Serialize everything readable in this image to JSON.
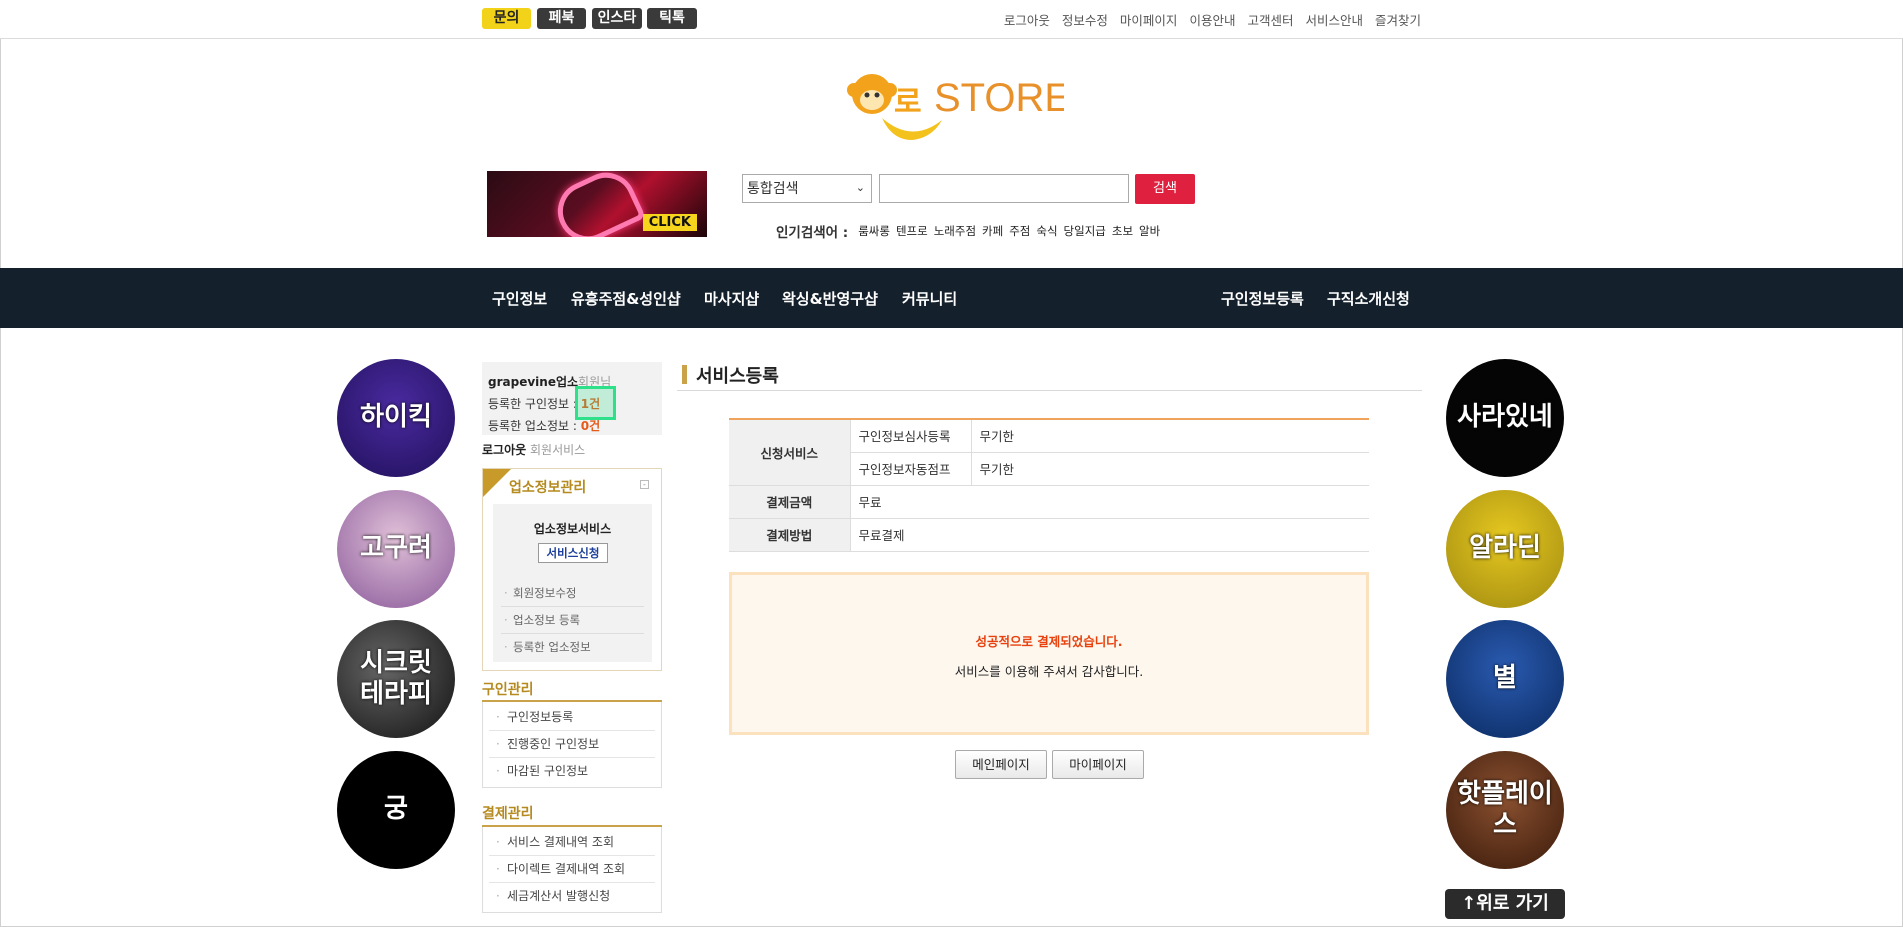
{
  "top": {
    "sns": [
      "문의",
      "페북",
      "인스타",
      "틱톡"
    ],
    "links": [
      "로그아웃",
      "정보수정",
      "마이페이지",
      "이용안내",
      "고객센터",
      "서비스안내",
      "즐겨찾기"
    ]
  },
  "logo": {
    "text": "STORE",
    "prefix": "로"
  },
  "banner": {
    "click": "CLICK"
  },
  "search": {
    "select_value": "통합검색",
    "button": "검색",
    "popular_label": "인기검색어 :",
    "keywords": [
      "룸싸롱",
      "텐프로",
      "노래주점",
      "카페",
      "주점",
      "숙식",
      "당일지급",
      "초보",
      "알바"
    ]
  },
  "nav": {
    "left": [
      "구인정보",
      "유흥주점&성인샵",
      "마사지샵",
      "왁싱&반영구샵",
      "커뮤니티"
    ],
    "right": [
      "구인정보등록",
      "구직소개신청"
    ]
  },
  "left_circles": [
    "하이킥",
    "고구려",
    "시크릿\n테라피",
    "궁"
  ],
  "right_circles": [
    "사라있네",
    "알라딘",
    "별",
    "핫플레이스"
  ],
  "top_button": "↑위로 가기",
  "member": {
    "name": "grapevine업소",
    "suffix": "회원님",
    "jobs_label": "등록한 구인정보 :",
    "jobs_count": "1건",
    "biz_label": "등록한 업소정보 :",
    "biz_count": "0건",
    "logout": "로그아웃",
    "member_service": "회원서비스"
  },
  "biz_panel": {
    "title": "업소정보관리",
    "subtitle": "업소정보서비스",
    "apply": "서비스신청",
    "items": [
      "회원정보수정",
      "업소정보 등록",
      "등록한 업소정보"
    ]
  },
  "job_section": {
    "title": "구인관리",
    "items": [
      "구인정보등록",
      "진행중인 구인정보",
      "마감된 구인정보"
    ]
  },
  "pay_section": {
    "title": "결제관리",
    "items": [
      "서비스 결제내역 조회",
      "다이렉트 결제내역 조회",
      "세금계산서 발행신청"
    ]
  },
  "main": {
    "title": "서비스등록",
    "table": {
      "service_label": "신청서비스",
      "services": [
        {
          "name": "구인정보심사등록",
          "period": "무기한"
        },
        {
          "name": "구인정보자동점프",
          "period": "무기한"
        }
      ],
      "amount_label": "결제금액",
      "amount": "무료",
      "method_label": "결제방법",
      "method": "무료결제"
    },
    "success": "성공적으로 결제되었습니다.",
    "thanks": "서비스를 이용해 주셔서 감사합니다.",
    "btn_main": "메인페이지",
    "btn_my": "마이페이지"
  }
}
